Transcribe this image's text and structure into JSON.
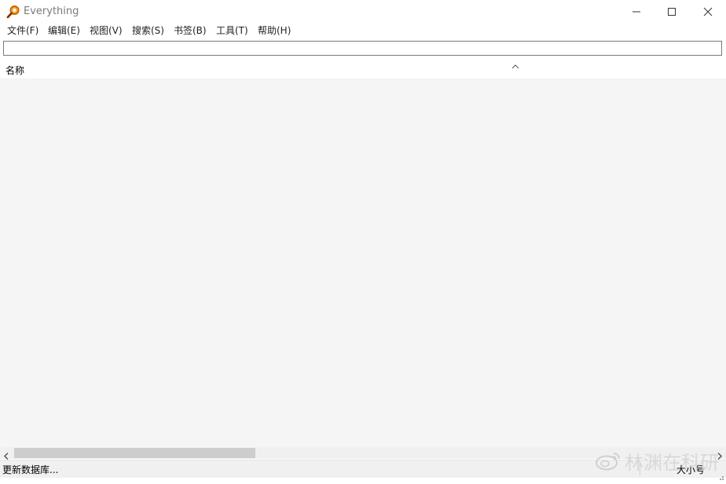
{
  "window": {
    "title": "Everything",
    "icon": "magnifier-icon",
    "controls": [
      "minimize-icon",
      "maximize-icon",
      "close-icon"
    ]
  },
  "menu": {
    "items": [
      "文件(F)",
      "编辑(E)",
      "视图(V)",
      "搜索(S)",
      "书签(B)",
      "工具(T)",
      "帮助(H)"
    ]
  },
  "search": {
    "value": ""
  },
  "list": {
    "columns": [
      "名称"
    ],
    "rows": []
  },
  "status": {
    "left": "更新数据库...",
    "right": "大小号"
  },
  "watermark": {
    "text": "林渊在科研",
    "icon": "weibo-icon"
  },
  "colors": {
    "accent": "#e06a00",
    "list_background": "#f5f5f5"
  }
}
